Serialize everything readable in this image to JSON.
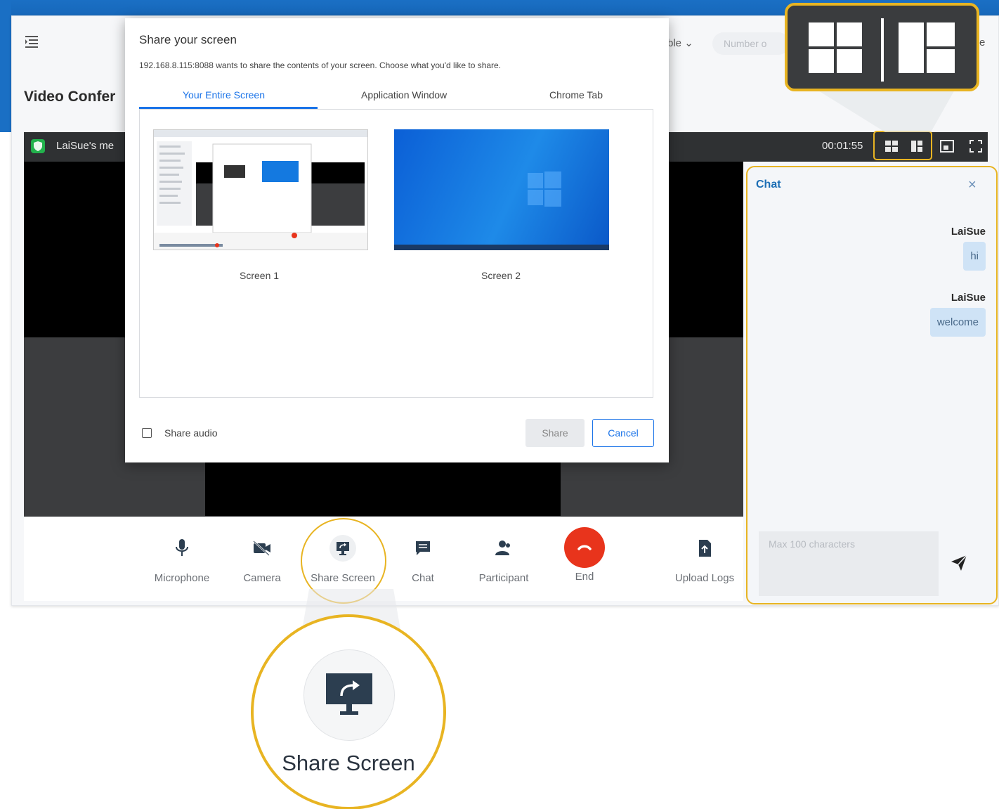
{
  "header": {
    "title": "Video Confer",
    "select_label": "ble",
    "number_placeholder": "Number o",
    "select2_label": "e"
  },
  "meeting": {
    "name": "LaiSue's me",
    "timer": "00:01:55"
  },
  "controls": [
    {
      "label": "Microphone",
      "icon": "microphone-icon"
    },
    {
      "label": "Camera",
      "icon": "camera-off-icon"
    },
    {
      "label": "Share Screen",
      "icon": "share-screen-icon"
    },
    {
      "label": "Chat",
      "icon": "chat-icon"
    },
    {
      "label": "Participant",
      "icon": "participant-icon"
    },
    {
      "label": "End",
      "icon": "end-call-icon"
    },
    {
      "label": "Upload Logs",
      "icon": "upload-logs-icon"
    }
  ],
  "chat": {
    "title": "Chat",
    "messages": [
      {
        "sender": "LaiSue",
        "text": "hi"
      },
      {
        "sender": "LaiSue",
        "text": "welcome"
      }
    ],
    "input_placeholder": "Max 100 characters"
  },
  "dialog": {
    "title": "Share your screen",
    "description": "192.168.8.115:8088 wants to share the contents of your screen. Choose what you'd like to share.",
    "tabs": [
      "Your Entire Screen",
      "Application Window",
      "Chrome Tab"
    ],
    "screens": [
      "Screen 1",
      "Screen 2"
    ],
    "share_audio_label": "Share audio",
    "share_button": "Share",
    "cancel_button": "Cancel"
  },
  "zoom": {
    "label": "Share Screen"
  },
  "colors": {
    "highlight": "#e8b422",
    "end_call": "#e8341c",
    "brand_blue": "#1a6fc4",
    "accent": "#1a73e8"
  }
}
